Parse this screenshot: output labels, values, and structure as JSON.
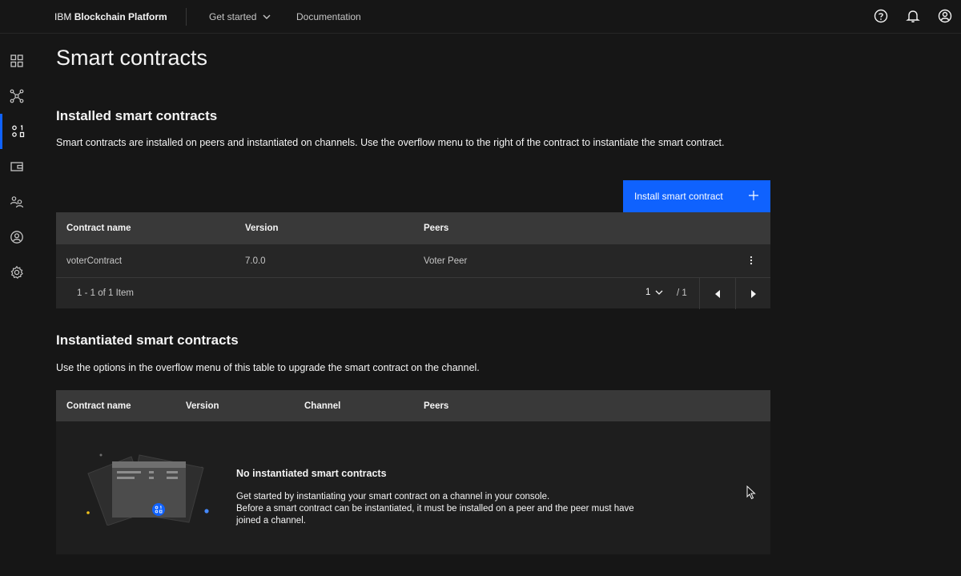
{
  "header": {
    "brand_prefix": "IBM",
    "brand_name": "Blockchain Platform",
    "nav": [
      {
        "label": "Get started"
      },
      {
        "label": "Documentation"
      }
    ]
  },
  "sidenav": {
    "items": [
      {
        "icon": "dashboard-icon"
      },
      {
        "icon": "network-icon"
      },
      {
        "icon": "smart-contracts-icon",
        "active": true
      },
      {
        "icon": "wallet-icon"
      },
      {
        "icon": "users-icon"
      },
      {
        "icon": "organizations-icon"
      },
      {
        "icon": "settings-icon"
      }
    ]
  },
  "page": {
    "title": "Smart contracts"
  },
  "installed": {
    "title": "Installed smart contracts",
    "description": "Smart contracts are installed on peers and instantiated on channels. Use the overflow menu to the right of the contract to instantiate the smart contract.",
    "install_button": "Install smart contract",
    "columns": [
      "Contract name",
      "Version",
      "Peers"
    ],
    "rows": [
      {
        "name": "voterContract",
        "version": "7.0.0",
        "peers": "Voter Peer"
      }
    ],
    "pagination": {
      "count": "1 - 1 of 1 Item",
      "page": "1",
      "total": "/ 1"
    }
  },
  "instantiated": {
    "title": "Instantiated smart contracts",
    "description": "Use the options in the overflow menu of this table to upgrade the smart contract on the channel.",
    "columns": [
      "Contract name",
      "Version",
      "Channel",
      "Peers"
    ],
    "empty_title": "No instantiated smart contracts",
    "empty_line1": "Get started by instantiating your smart contract on a channel in your console.",
    "empty_line2": "Before a smart contract can be instantiated, it must be installed on a peer and the peer must have joined a channel."
  },
  "colors": {
    "accent": "#0f62fe",
    "background": "#161616",
    "table_header": "#393939",
    "table_row": "#262626"
  }
}
